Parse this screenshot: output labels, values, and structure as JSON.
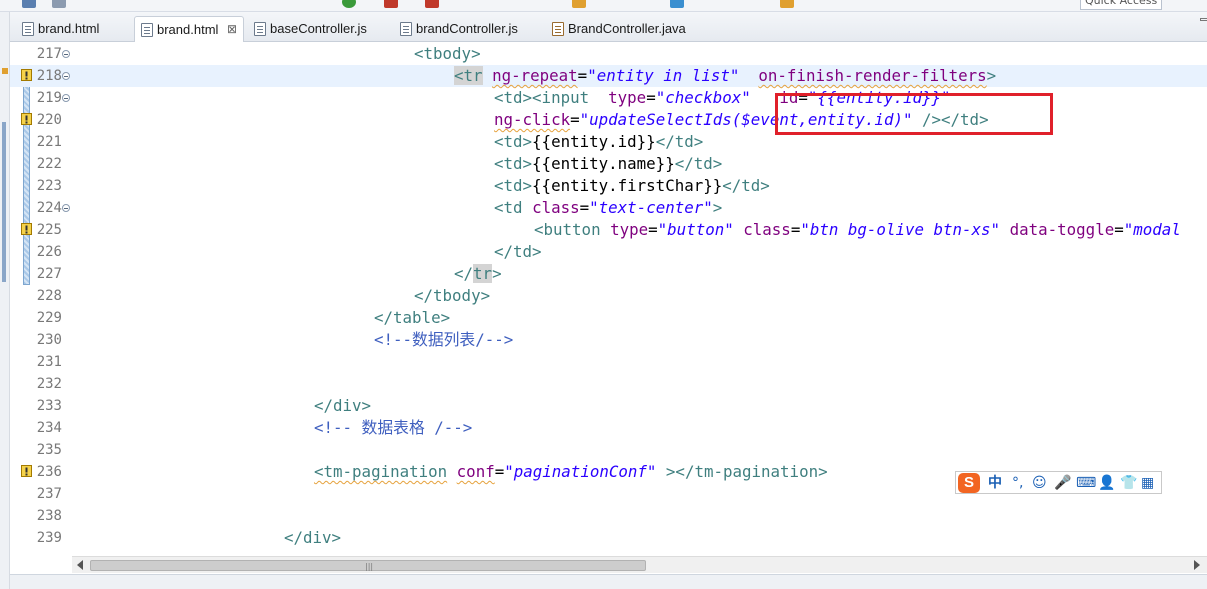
{
  "tabs": [
    {
      "label": "brand.html",
      "icon": "html-file-icon",
      "active": false
    },
    {
      "label": "brand.html",
      "icon": "html-file-icon",
      "active": true,
      "close": "⊠"
    },
    {
      "label": "baseController.js",
      "icon": "js-file-icon",
      "active": false
    },
    {
      "label": "brandController.js",
      "icon": "js-file-icon",
      "active": false
    },
    {
      "label": "BrandController.java",
      "icon": "java-file-icon",
      "active": false
    }
  ],
  "toolbar": {
    "quick_access": "Quick Access"
  },
  "editor": {
    "current_line": "218",
    "lines": [
      {
        "num": "217"
      },
      {
        "num": "218"
      },
      {
        "num": "219"
      },
      {
        "num": "220"
      },
      {
        "num": "221"
      },
      {
        "num": "222"
      },
      {
        "num": "223"
      },
      {
        "num": "224"
      },
      {
        "num": "225"
      },
      {
        "num": "226"
      },
      {
        "num": "227"
      },
      {
        "num": "228"
      },
      {
        "num": "229"
      },
      {
        "num": "230"
      },
      {
        "num": "231"
      },
      {
        "num": "232"
      },
      {
        "num": "233"
      },
      {
        "num": "234"
      },
      {
        "num": "235"
      },
      {
        "num": "236"
      },
      {
        "num": "237"
      },
      {
        "num": "238"
      },
      {
        "num": "239"
      }
    ],
    "code": {
      "l217": "<tbody>",
      "l218_tag": "<tr",
      "l218_attr1": "ng-repeat",
      "l218_val1": "\"entity in list\"",
      "l218_attr2": "on-finish-render-filters",
      "l218_end": ">",
      "l219_tags": "<td><input",
      "l219_attr1": "type",
      "l219_val1": "\"checkbox\"",
      "l219_attr2": "id",
      "l219_val2": "\"{{entity.id}}\"",
      "l220_attr": "ng-click",
      "l220_val": "\"updateSelectIds($event,entity.id)\"",
      "l220_end": "/></td>",
      "l221_open": "<td>",
      "l221_text": "{{entity.id}}",
      "l221_close": "</td>",
      "l222_open": "<td>",
      "l222_text": "{{entity.name}}",
      "l222_close": "</td>",
      "l223_open": "<td>",
      "l223_text": "{{entity.firstChar}}",
      "l223_close": "</td>",
      "l224_tag": "<td",
      "l224_attr": "class",
      "l224_val": "\"text-center\"",
      "l224_end": ">",
      "l225_tag": "<button",
      "l225_attr1": "type",
      "l225_val1": "\"button\"",
      "l225_attr2": "class",
      "l225_val2": "\"btn bg-olive btn-xs\"",
      "l225_attr3": "data-toggle",
      "l225_val3": "\"modal",
      "l226": "</td>",
      "l227_open": "</",
      "l227_tr": "tr",
      "l227_close": ">",
      "l228": "</tbody>",
      "l229": "</table>",
      "l230": "<!--数据列表/-->",
      "l233": "</div>",
      "l234": "<!-- 数据表格 /-->",
      "l236_tag": "<tm-pagination",
      "l236_attr": "conf",
      "l236_val": "\"paginationConf\"",
      "l236_end": "></tm-pagination>",
      "l239": "</div>"
    }
  },
  "ime": {
    "logo": "S",
    "items": [
      "中",
      "°,",
      "☺",
      "🎤",
      "⌨",
      "👤",
      "👕",
      "▦"
    ]
  },
  "colors": {
    "tag": "#3f7f7f",
    "attr": "#7f007f",
    "value": "#2a00ff",
    "highlight_box": "#e0202a",
    "current_line": "#e8f2fe"
  }
}
